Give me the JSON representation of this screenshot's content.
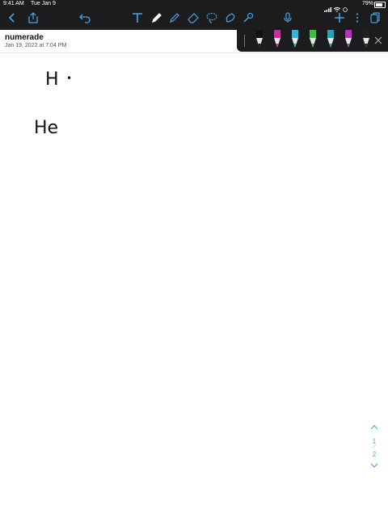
{
  "status_bar": {
    "time": "9:41 AM",
    "date": "Tue Jan 9",
    "battery": "79%"
  },
  "toolbar": {
    "icons": [
      "back-icon",
      "share-icon",
      "undo-icon",
      "text-tool-icon",
      "pen-tool-icon",
      "highlighter-tool-icon",
      "eraser-tool-icon",
      "lasso-tool-icon",
      "image-tool-icon",
      "laser-tool-icon",
      "microphone-icon",
      "add-icon",
      "more-icon",
      "pages-icon"
    ]
  },
  "document": {
    "title": "numerade",
    "date": "Jan 19, 2022 at 7:04 PM"
  },
  "pens": [
    {
      "color": "#111111"
    },
    {
      "color": "#d5289c"
    },
    {
      "color": "#2fb7e0"
    },
    {
      "color": "#3fbf3f"
    },
    {
      "color": "#1ea7b8"
    },
    {
      "color": "#b82fb8"
    },
    {
      "color": "#222222"
    }
  ],
  "canvas": {
    "line1_symbol": "H",
    "line1_dot": "•",
    "line2_symbol": "He"
  },
  "pager": {
    "current": "1",
    "total": "2"
  }
}
